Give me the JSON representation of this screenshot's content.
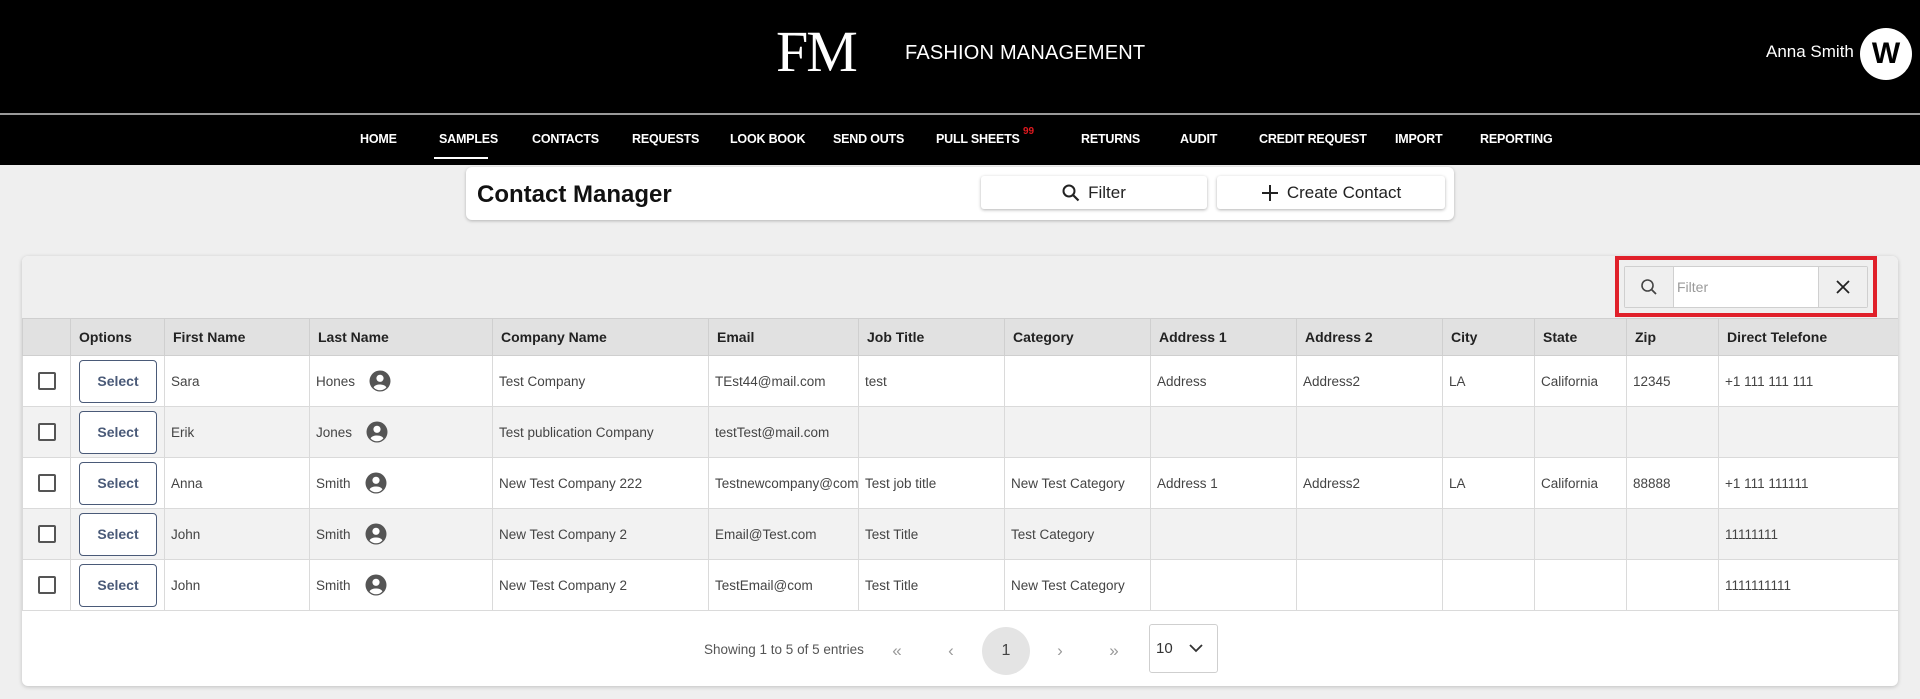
{
  "header": {
    "logo": "FM",
    "brand": "FASHION MANAGEMENT",
    "user_name": "Anna Smith",
    "avatar_letter": "W"
  },
  "nav": {
    "items": [
      "HOME",
      "SAMPLES",
      "CONTACTS",
      "REQUESTS",
      "LOOK BOOK",
      "SEND OUTS",
      "PULL SHEETS",
      "RETURNS",
      "AUDIT",
      "CREDIT REQUEST",
      "IMPORT",
      "REPORTING"
    ],
    "active": "SAMPLES",
    "pull_sheets_badge": "99"
  },
  "title_panel": {
    "title": "Contact Manager",
    "filter_label": "Filter",
    "create_label": "Create Contact"
  },
  "search": {
    "placeholder": "Filter",
    "value": ""
  },
  "table": {
    "columns": [
      "",
      "Options",
      "First Name",
      "Last Name",
      "Company Name",
      "Email",
      "Job Title",
      "Category",
      "Address 1",
      "Address 2",
      "City",
      "State",
      "Zip",
      "Direct Telefone"
    ],
    "select_label": "Select",
    "rows": [
      {
        "first": "Sara",
        "last": "Hones",
        "company": "Test Company",
        "email": "TEst44@mail.com",
        "job": "test",
        "category": "",
        "addr1": "Address",
        "addr2": "Address2",
        "city": "LA",
        "state": "California",
        "zip": "12345",
        "phone": "+1 111 111 111"
      },
      {
        "first": "Erik",
        "last": "Jones",
        "company": "Test publication Company",
        "email": "testTest@mail.com",
        "job": "",
        "category": "",
        "addr1": "",
        "addr2": "",
        "city": "",
        "state": "",
        "zip": "",
        "phone": ""
      },
      {
        "first": "Anna",
        "last": "Smith",
        "company": "New Test Company 222",
        "email": "Testnewcompany@com",
        "job": "Test job title",
        "category": "New Test Category",
        "addr1": "Address 1",
        "addr2": "Address2",
        "city": "LA",
        "state": "California",
        "zip": "88888",
        "phone": "+1 111 111111"
      },
      {
        "first": "John",
        "last": "Smith",
        "company": "New Test Company 2",
        "email": "Email@Test.com",
        "job": "Test Title",
        "category": "Test Category",
        "addr1": "",
        "addr2": "",
        "city": "",
        "state": "",
        "zip": "",
        "phone": "11111111"
      },
      {
        "first": "John",
        "last": "Smith",
        "company": "New Test Company 2",
        "email": "TestEmail@com",
        "job": "Test Title",
        "category": "New Test Category",
        "addr1": "",
        "addr2": "",
        "city": "",
        "state": "",
        "zip": "",
        "phone": "1111111111"
      }
    ]
  },
  "pagination": {
    "summary": "Showing 1 to 5 of 5 entries",
    "first": "«",
    "prev": "‹",
    "current_page": "1",
    "next": "›",
    "last": "»",
    "page_size": "10"
  },
  "colors": {
    "header_bg": "#000000",
    "page_bg": "#efefef",
    "highlight": "#e0202a",
    "badge": "#e0191f",
    "select_button": "#4a5a78"
  },
  "icons": [
    "search-icon",
    "plus-icon",
    "close-icon",
    "person-icon",
    "chevron-down-icon",
    "double-chevron-left-icon",
    "chevron-left-icon",
    "chevron-right-icon",
    "double-chevron-right-icon"
  ]
}
